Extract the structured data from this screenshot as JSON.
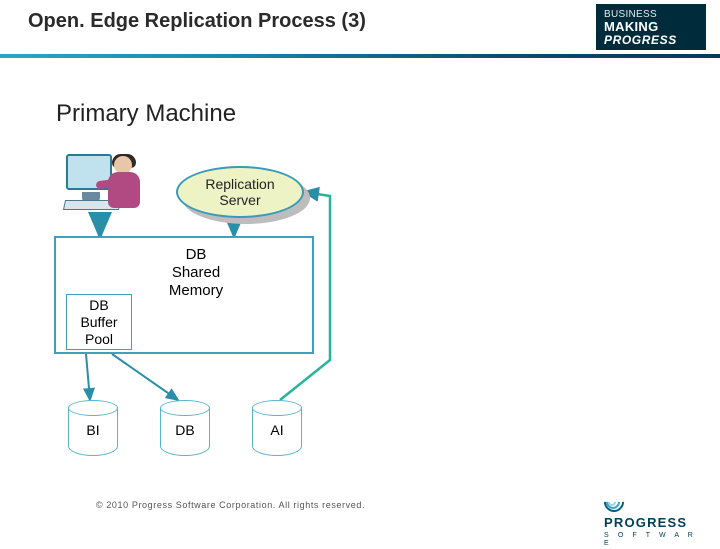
{
  "header": {
    "title": "Open. Edge Replication Process (3)",
    "logo": {
      "line1": "BUSINESS",
      "line2": "MAKING",
      "line3": "PROGRESS"
    }
  },
  "diagram": {
    "subheading": "Primary Machine",
    "replication_server": {
      "line1": "Replication",
      "line2": "Server"
    },
    "shared_memory": {
      "line1": "DB",
      "line2": "Shared",
      "line3": "Memory"
    },
    "buffer_pool": {
      "line1": "DB",
      "line2": "Buffer",
      "line3": "Pool"
    },
    "cylinders": {
      "bi": "BI",
      "db": "DB",
      "ai": "AI"
    },
    "user_icon_name": "user-at-workstation"
  },
  "footer": {
    "copyright": "© 2010 Progress Software Corporation. All rights reserved.",
    "logo": {
      "word": "PROGRESS",
      "sub": "S O F T W A R E"
    }
  },
  "chart_data": {
    "type": "diagram",
    "title": "OpenEdge Replication Process (3) – Primary Machine",
    "nodes": [
      {
        "id": "user",
        "label": "User / Client",
        "kind": "actor"
      },
      {
        "id": "repl",
        "label": "Replication Server",
        "kind": "process-oval"
      },
      {
        "id": "shm",
        "label": "DB Shared Memory",
        "kind": "container"
      },
      {
        "id": "bufpool",
        "label": "DB Buffer Pool",
        "kind": "box",
        "parent": "shm"
      },
      {
        "id": "bi",
        "label": "BI",
        "kind": "datastore-cylinder"
      },
      {
        "id": "db",
        "label": "DB",
        "kind": "datastore-cylinder"
      },
      {
        "id": "ai",
        "label": "AI",
        "kind": "datastore-cylinder"
      }
    ],
    "edges": [
      {
        "from": "user",
        "to": "shm"
      },
      {
        "from": "repl",
        "to": "shm"
      },
      {
        "from": "bufpool",
        "to": "bi"
      },
      {
        "from": "bufpool",
        "to": "db"
      },
      {
        "from": "ai",
        "to": "repl"
      }
    ]
  }
}
